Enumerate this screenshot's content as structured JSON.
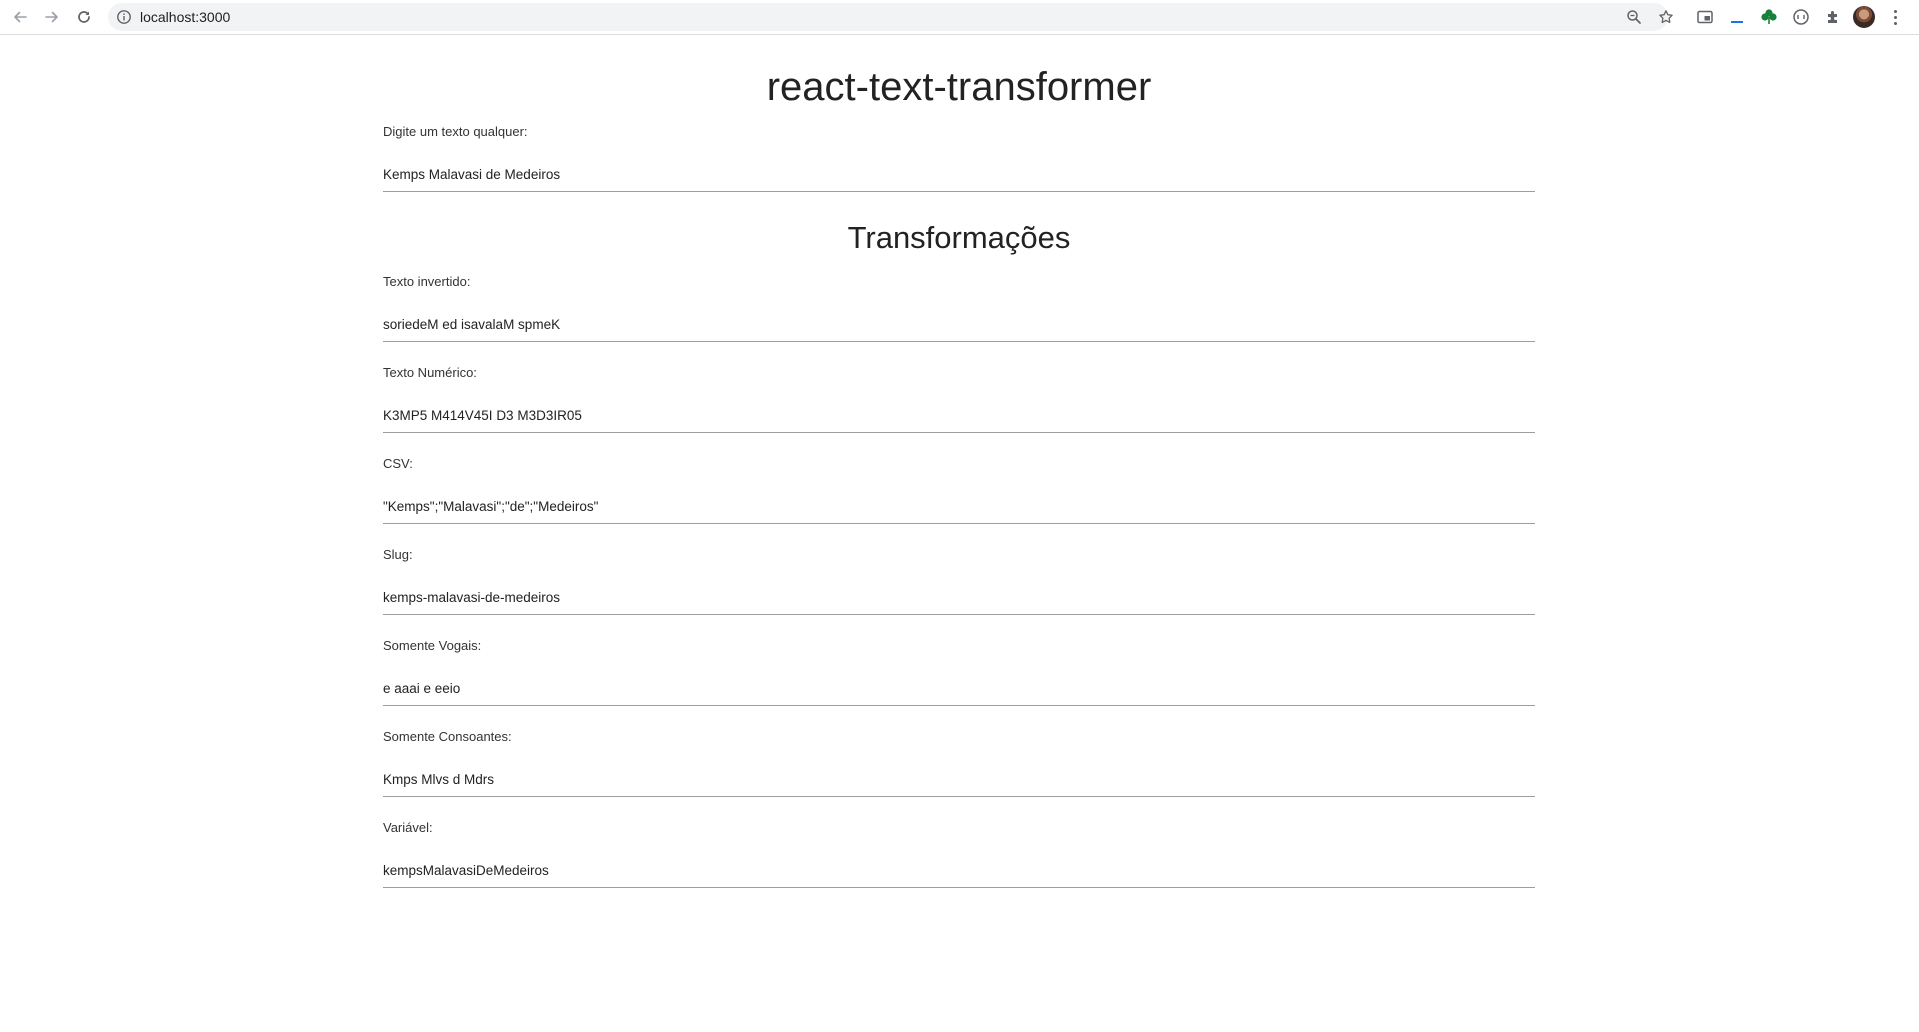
{
  "browser": {
    "url": "localhost:3000"
  },
  "app": {
    "title": "react-text-transformer",
    "input": {
      "label": "Digite um texto qualquer:",
      "value": "Kemps Malavasi de Medeiros"
    },
    "transformations_title": "Transformações",
    "transformations": [
      {
        "label": "Texto invertido:",
        "value": "soriedeM ed isavalaM spmeK"
      },
      {
        "label": "Texto Numérico:",
        "value": "K3MP5 M414V45I D3 M3D3IR05"
      },
      {
        "label": "CSV:",
        "value": "\"Kemps\";\"Malavasi\";\"de\";\"Medeiros\""
      },
      {
        "label": "Slug:",
        "value": "kemps-malavasi-de-medeiros"
      },
      {
        "label": "Somente Vogais:",
        "value": "e aaai e eeio"
      },
      {
        "label": "Somente Consoantes:",
        "value": "Kmps Mlvs d Mdrs"
      },
      {
        "label": "Variável:",
        "value": "kempsMalavasiDeMedeiros"
      }
    ]
  },
  "colors": {
    "text": "#222222",
    "underline": "#9e9e9e",
    "omnibox_bg": "#f1f3f4",
    "icon": "#5f6368",
    "leaf_green": "#188038",
    "accent_blue": "#1a73e8"
  }
}
